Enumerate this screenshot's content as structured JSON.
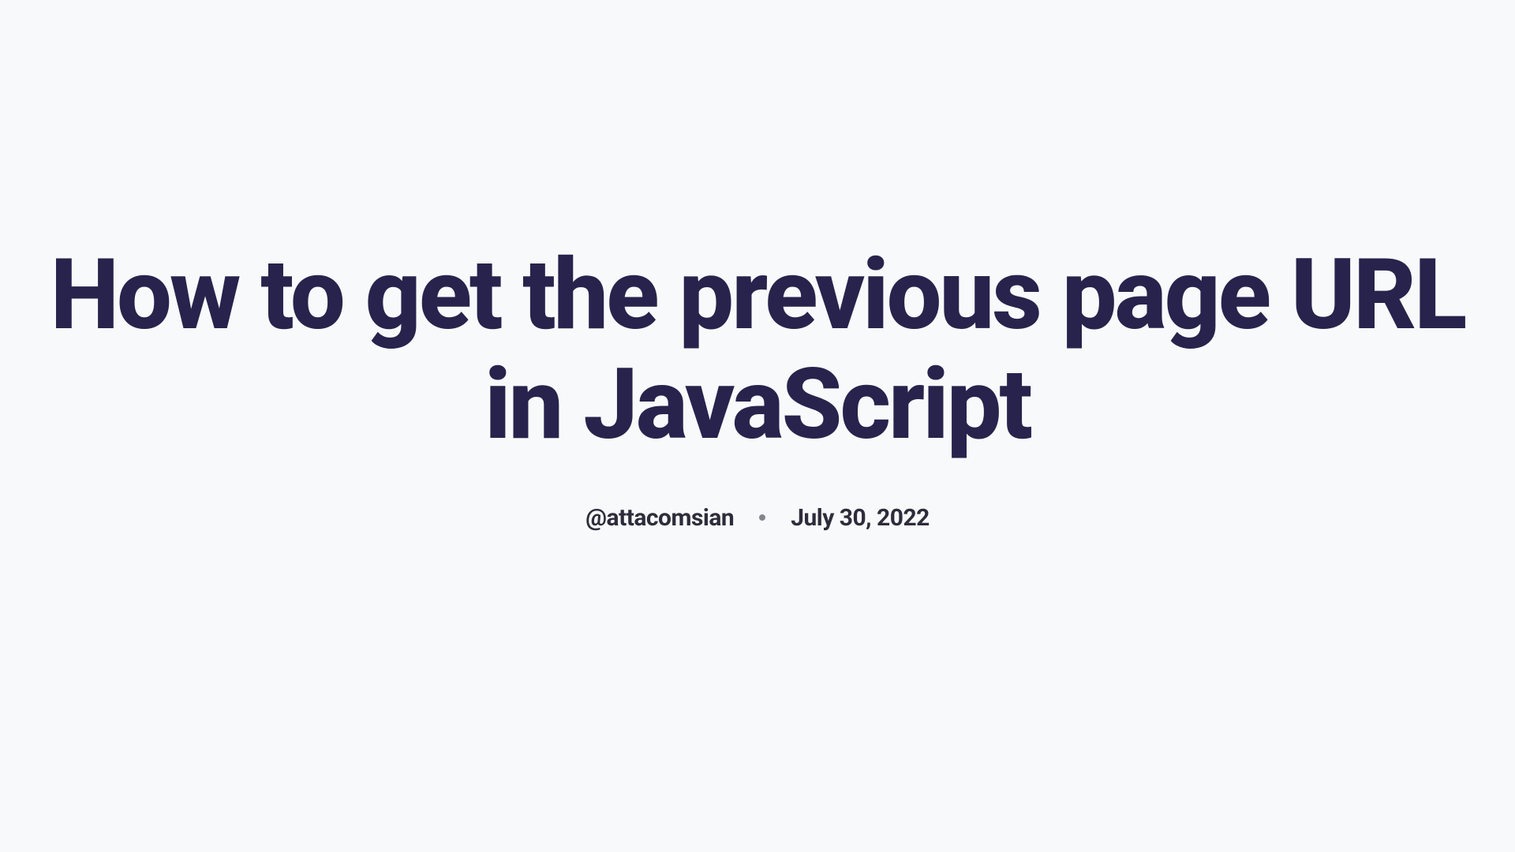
{
  "title": "How to get the previous page URL in JavaScript",
  "meta": {
    "author": "@attacomsian",
    "date": "July 30, 2022"
  }
}
